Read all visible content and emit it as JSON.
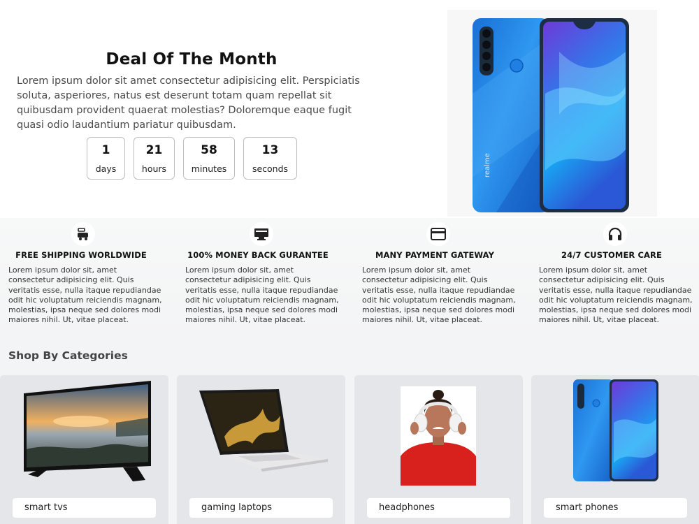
{
  "deal": {
    "title": "Deal Of The Month",
    "description": "Lorem ipsum dolor sit amet consectetur adipisicing elit. Perspiciatis soluta, asperiores, natus est deserunt totam quam repellat sit quibusdam provident quaerat molestias? Doloremque eaque fugit quasi odio laudantium pariatur quibusdam.",
    "countdown": [
      {
        "value": "1",
        "unit": "days"
      },
      {
        "value": "21",
        "unit": "hours"
      },
      {
        "value": "58",
        "unit": "minutes"
      },
      {
        "value": "13",
        "unit": "seconds"
      }
    ],
    "phone_brand": "realme"
  },
  "features": [
    {
      "icon": "delivery-truck-icon",
      "title": "FREE SHIPPING WORLDWIDE",
      "text": "Lorem ipsum dolor sit, amet consectetur adipisicing elit. Quis veritatis esse, nulla itaque repudiandae odit hic voluptatum reiciendis magnam, molestias, ipsa neque sed dolores modi maiores nihil. Ut, vitae placeat."
    },
    {
      "icon": "money-bill-icon",
      "title": "100% MONEY BACK GURANTEE",
      "text": "Lorem ipsum dolor sit, amet consectetur adipisicing elit. Quis veritatis esse, nulla itaque repudiandae odit hic voluptatum reiciendis magnam, molestias, ipsa neque sed dolores modi maiores nihil. Ut, vitae placeat."
    },
    {
      "icon": "credit-card-icon",
      "title": "MANY PAYMENT GATEWAY",
      "text": "Lorem ipsum dolor sit, amet consectetur adipisicing elit. Quis veritatis esse, nulla itaque repudiandae odit hic voluptatum reiciendis magnam, molestias, ipsa neque sed dolores modi maiores nihil. Ut, vitae placeat."
    },
    {
      "icon": "headset-icon",
      "title": "24/7 CUSTOMER CARE",
      "text": "Lorem ipsum dolor sit, amet consectetur adipisicing elit. Quis veritatis esse, nulla itaque repudiandae odit hic voluptatum reiciendis magnam, molestias, ipsa neque sed dolores modi maiores nihil. Ut, vitae placeat."
    }
  ],
  "categories": {
    "heading": "Shop By Categories",
    "items": [
      {
        "label": "smart tvs",
        "image": "television-image"
      },
      {
        "label": "gaming laptops",
        "image": "laptop-image"
      },
      {
        "label": "headphones",
        "image": "headphones-image"
      },
      {
        "label": "smart phones",
        "image": "smartphone-image"
      }
    ]
  },
  "colors": {
    "phone_blue": "#1e7de0",
    "phone_purple": "#6a3fd8",
    "headphone_shirt_red": "#d8201c",
    "feature_band": "#f6f7f7",
    "category_card": "#e5e6ea"
  }
}
